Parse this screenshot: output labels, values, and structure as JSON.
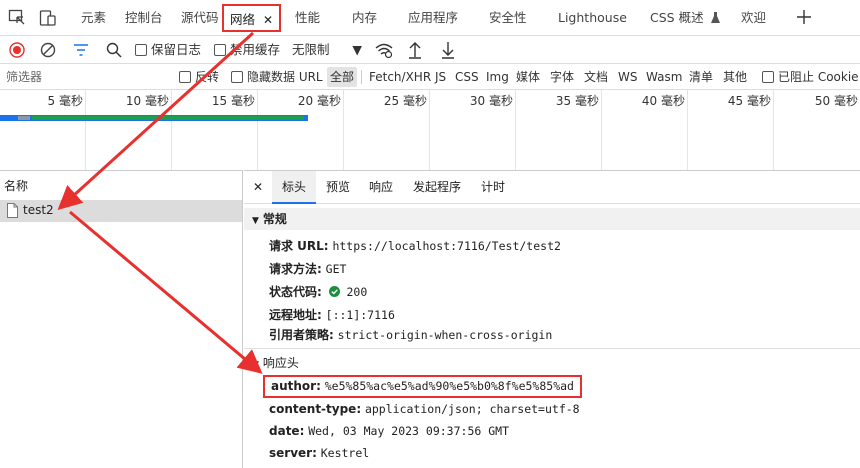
{
  "tabs": [
    {
      "label": "元素"
    },
    {
      "label": "控制台"
    },
    {
      "label": "源代码"
    },
    {
      "label": "网络"
    },
    {
      "label": "性能"
    },
    {
      "label": "内存"
    },
    {
      "label": "应用程序"
    },
    {
      "label": "安全性"
    },
    {
      "label": "Lighthouse"
    },
    {
      "label": "CSS 概述"
    },
    {
      "label": "欢迎"
    }
  ],
  "toolbar": {
    "preserve_log": "保留日志",
    "disable_cache": "禁用缓存",
    "throttle": "无限制"
  },
  "filter": {
    "placeholder": "筛选器",
    "invert": "反转",
    "hide_data_url": "隐藏数据 URL",
    "types": [
      "全部",
      "Fetch/XHR",
      "JS",
      "CSS",
      "Img",
      "媒体",
      "字体",
      "文档",
      "WS",
      "Wasm",
      "清单",
      "其他"
    ],
    "blocked_cookies": "已阻止 Cookie"
  },
  "timeline": {
    "ticks": [
      "5 毫秒",
      "10 毫秒",
      "15 毫秒",
      "20 毫秒",
      "25 毫秒",
      "30 毫秒",
      "35 毫秒",
      "40 毫秒",
      "45 毫秒",
      "50 毫秒"
    ]
  },
  "requests": {
    "column": "名称",
    "items": [
      {
        "name": "test2"
      }
    ]
  },
  "detail": {
    "tabs": [
      "标头",
      "预览",
      "响应",
      "发起程序",
      "计时"
    ],
    "general": {
      "title": "常规",
      "rows": [
        {
          "key": "请求 URL:",
          "value": "https://localhost:7116/Test/test2"
        },
        {
          "key": "请求方法:",
          "value": "GET"
        },
        {
          "key": "状态代码:",
          "value": "200"
        },
        {
          "key": "远程地址:",
          "value": "[::1]:7116"
        },
        {
          "key": "引用者策略:",
          "value": "strict-origin-when-cross-origin"
        }
      ]
    },
    "response_headers": {
      "title": "响应头",
      "rows": [
        {
          "key": "author:",
          "value": "%e5%85%ac%e5%ad%90%e5%b0%8f%e5%85%ad"
        },
        {
          "key": "content-type:",
          "value": "application/json; charset=utf-8"
        },
        {
          "key": "date:",
          "value": "Wed, 03 May 2023 09:37:56 GMT"
        },
        {
          "key": "server:",
          "value": "Kestrel"
        }
      ]
    }
  },
  "colors": {
    "highlight_red": "#e8302e",
    "accent_blue": "#1a73e8",
    "status_green": "#1e8e3e"
  }
}
